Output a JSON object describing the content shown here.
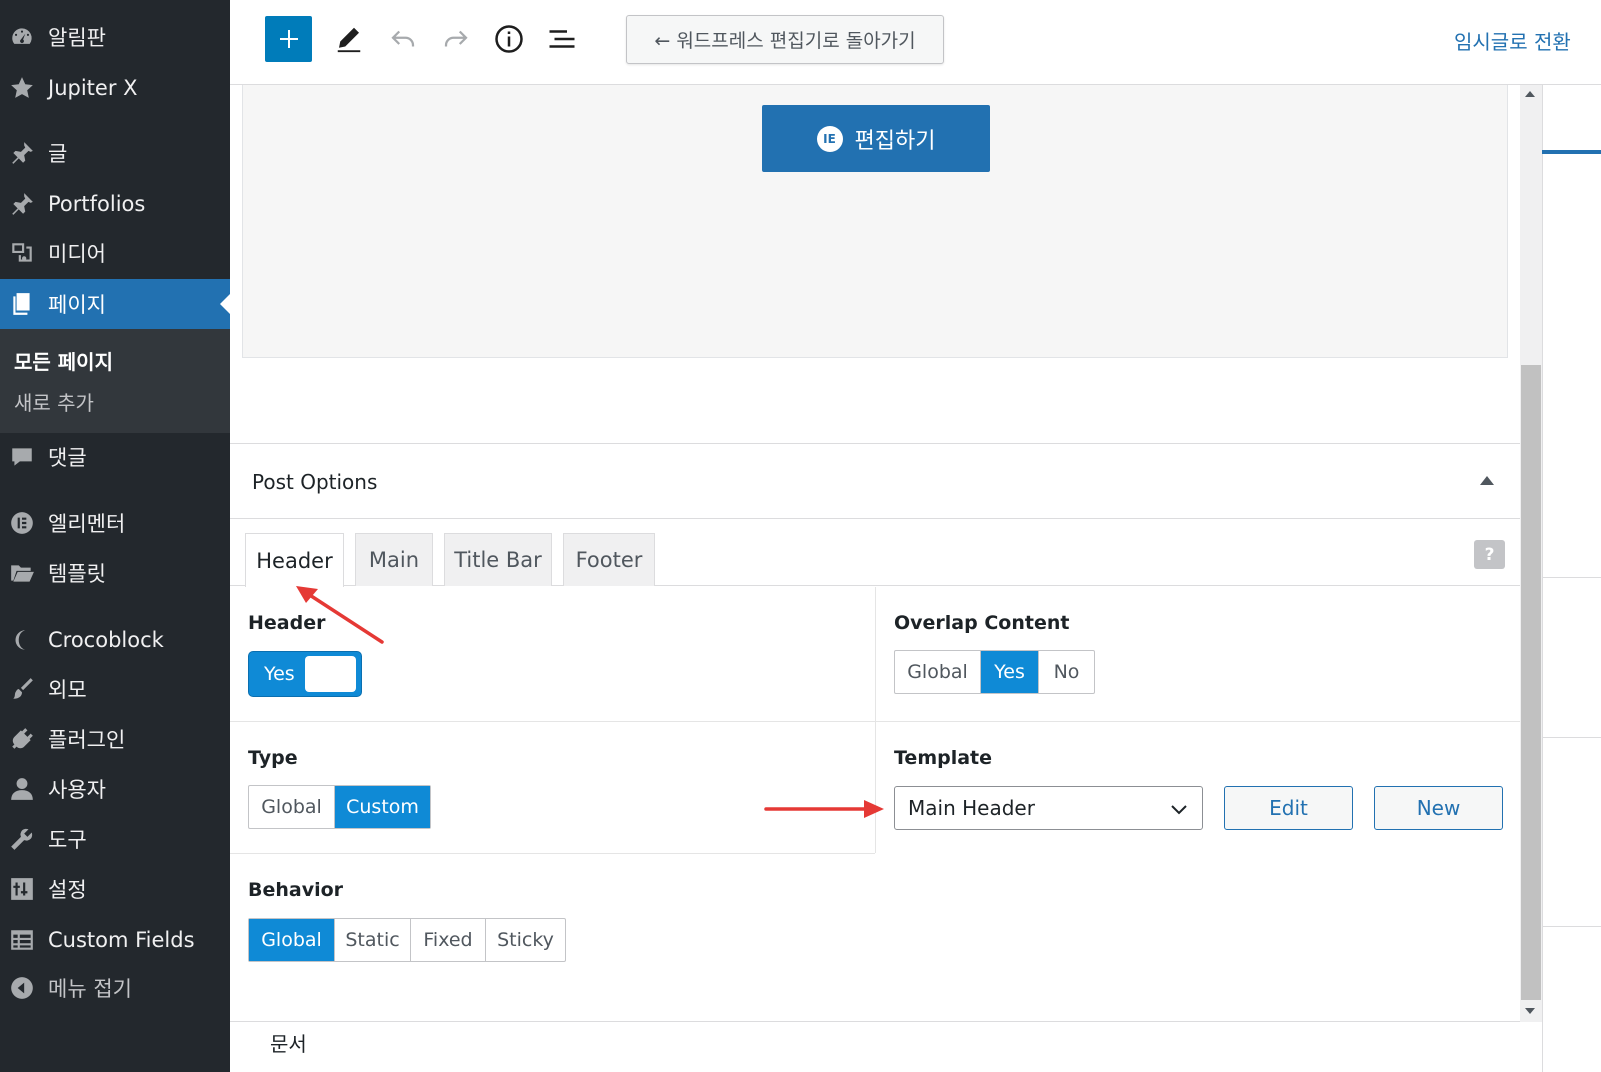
{
  "sidebar": {
    "items": [
      {
        "label": "알림판",
        "icon": "dashboard-icon"
      },
      {
        "label": "Jupiter X",
        "icon": "star-icon"
      },
      {
        "label": "글",
        "icon": "pin-icon"
      },
      {
        "label": "Portfolios",
        "icon": "pin-icon"
      },
      {
        "label": "미디어",
        "icon": "media-icon"
      },
      {
        "label": "페이지",
        "icon": "pages-icon"
      },
      {
        "label": "댓글",
        "icon": "comment-icon"
      },
      {
        "label": "엘리멘터",
        "icon": "elementor-icon"
      },
      {
        "label": "템플릿",
        "icon": "folder-icon"
      },
      {
        "label": "Crocoblock",
        "icon": "crocoblock-icon"
      },
      {
        "label": "외모",
        "icon": "brush-icon"
      },
      {
        "label": "플러그인",
        "icon": "plugin-icon"
      },
      {
        "label": "사용자",
        "icon": "user-icon"
      },
      {
        "label": "도구",
        "icon": "wrench-icon"
      },
      {
        "label": "설정",
        "icon": "settings-icon"
      },
      {
        "label": "Custom Fields",
        "icon": "table-icon"
      },
      {
        "label": "메뉴 접기",
        "icon": "collapse-icon"
      }
    ],
    "submenu": [
      "모든 페이지",
      "새로 추가"
    ]
  },
  "toolbar": {
    "back_label": "← 워드프레스 편집기로 돌아가기",
    "draft_label": "임시글로 전환"
  },
  "canvas": {
    "edit_label": "편집하기"
  },
  "post_options": {
    "title": "Post Options",
    "tabs": [
      "Header",
      "Main",
      "Title Bar",
      "Footer"
    ],
    "help": "?",
    "header_label": "Header",
    "header_toggle": "Yes",
    "overlap_label": "Overlap Content",
    "overlap_options": [
      "Global",
      "Yes",
      "No"
    ],
    "type_label": "Type",
    "type_options": [
      "Global",
      "Custom"
    ],
    "template_label": "Template",
    "template_value": "Main Header",
    "edit_label": "Edit",
    "new_label": "New",
    "behavior_label": "Behavior",
    "behavior_options": [
      "Global",
      "Static",
      "Fixed",
      "Sticky"
    ]
  },
  "footer": {
    "label": "문서"
  },
  "colors": {
    "sidebar_bg": "#23282d",
    "accent": "#2271b1",
    "selected": "#0f8ad6",
    "arrow": "#e53935"
  }
}
